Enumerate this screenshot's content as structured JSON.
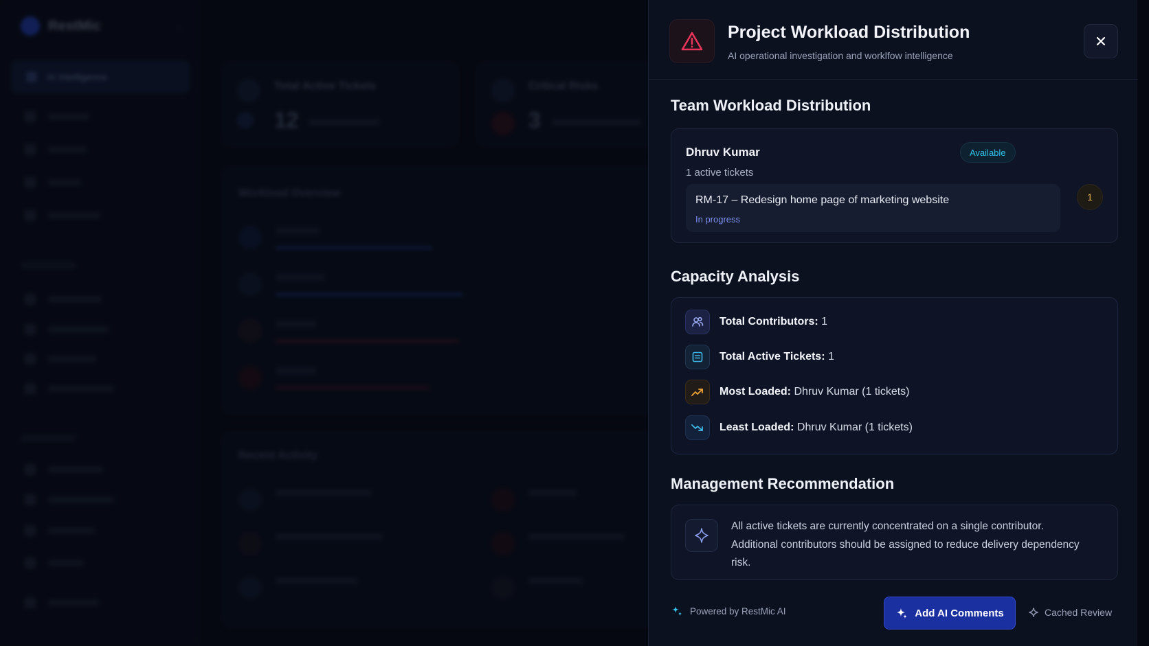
{
  "background": {
    "brand": "RestMic",
    "nav_active": "AI Intelligence",
    "stats": [
      {
        "title": "Total Active Tickets",
        "value": "12"
      },
      {
        "title": "Critical Risks",
        "value": "3"
      }
    ],
    "section_workload": "Workload Overview",
    "section_recent": "Recent Activity"
  },
  "panel": {
    "title": "Project Workload Distribution",
    "subtitle": "AI operational investigation and worklfow intelligence",
    "close_icon": "close-icon",
    "warning_icon": "warning-triangle-icon"
  },
  "team": {
    "section_title": "Team Workload Distribution",
    "member": {
      "name": "Dhruv Kumar",
      "badge": "Available",
      "active_tickets": "1 active tickets",
      "ticket_title": "RM-17 – Redesign home page of marketing website",
      "ticket_status": "In progress",
      "count": "1"
    }
  },
  "capacity": {
    "section_title": "Capacity Analysis",
    "rows": [
      {
        "label": "Total Contributors:",
        "value": " 1",
        "icon": "users-icon"
      },
      {
        "label": "Total Active Tickets:",
        "value": " 1",
        "icon": "list-icon"
      },
      {
        "label": "Most Loaded:",
        "value": " Dhruv Kumar (1 tickets)",
        "icon": "trending-up-icon"
      },
      {
        "label": "Least Loaded:",
        "value": " Dhruv Kumar (1 tickets)",
        "icon": "trending-down-icon"
      }
    ]
  },
  "recommendation": {
    "section_title": "Management Recommendation",
    "text": "All active tickets are currently concentrated on a single contributor. Additional contributors should be assigned to reduce delivery dependency risk."
  },
  "footer": {
    "powered_by": "Powered by RestMic AI",
    "add_button": "Add AI Comments",
    "cached": "Cached Review"
  },
  "colors": {
    "accent_blue": "#1a2fa0",
    "available_cyan": "#35c2e8",
    "warning_red": "#e8335a",
    "count_amber": "#e2b04a"
  }
}
